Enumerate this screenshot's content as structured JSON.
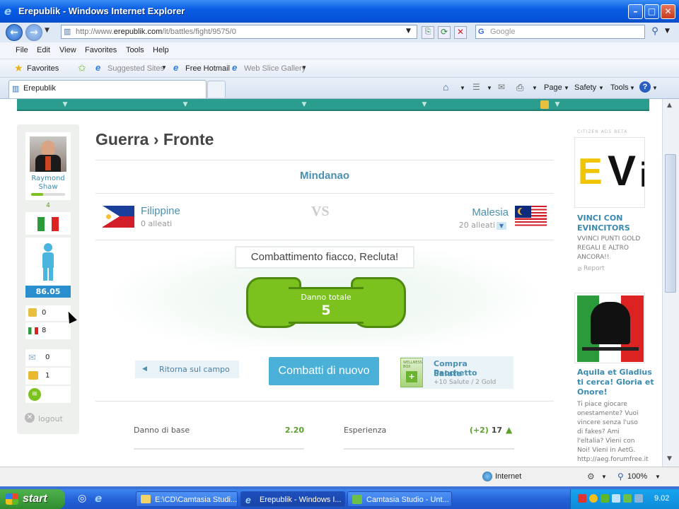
{
  "window": {
    "title": "Erepublik - Windows Internet Explorer"
  },
  "address": {
    "prefix": "http://www.",
    "domain": "erepublik.com",
    "suffix": "/it/battles/fight/9575/0"
  },
  "search": {
    "placeholder": "Google"
  },
  "menu": [
    "File",
    "Edit",
    "View",
    "Favorites",
    "Tools",
    "Help"
  ],
  "favorites": {
    "favorites_label": "Favorites",
    "suggested": "Suggested Sites",
    "hotmail": "Free Hotmail",
    "webslice": "Web Slice Gallery"
  },
  "tab": {
    "label": "Erepublik"
  },
  "commands": {
    "page": "Page",
    "safety": "Safety",
    "tools": "Tools"
  },
  "sidebar": {
    "user_name_1": "Raymond",
    "user_name_2": "Shaw",
    "level": "4",
    "wellness": "86.05",
    "gold": "0",
    "currency": "8",
    "messages": "0",
    "alerts": "1",
    "logout": "logout"
  },
  "main": {
    "title": "Guerra › Fronte",
    "region": "Mindanao",
    "left_country": "Filippine",
    "left_allies": "0 alleati",
    "vs": "VS",
    "right_country": "Malesia",
    "right_allies": "20 alleati",
    "message": "Combattimento fiacco, Recluta!",
    "damage_label": "Danno totale",
    "damage_value": "5",
    "return_label": "Ritorna sul campo",
    "fight_again": "Combatti di nuovo",
    "wellness_box_label": "WELLNESS BOX",
    "buy_pack_1": "Compra Pacchetto",
    "buy_pack_2": "Salute",
    "buy_pack_sub": "+10 Salute / 2 Gold",
    "base_damage_label": "Danno di base",
    "base_damage_value": "2.20",
    "experience_label": "Esperienza",
    "experience_delta": "(+2)",
    "experience_value": "17"
  },
  "ads": {
    "header": "CITIZEN ADS BETA",
    "ad1_title_1": "VINCI CON",
    "ad1_title_2": "EVINCITORS",
    "ad1_text_1": "VVINCI PUNTI GOLD",
    "ad1_text_2": "REGALI E ALTRO",
    "ad1_text_3": "ANCORA!!",
    "report": "Report",
    "ad2_title_1": "Aquila et Gladius",
    "ad2_title_2": "ti cerca! Gloria et",
    "ad2_title_3": "Onore!",
    "ad2_text": [
      "Ti piace giocare",
      "onestamente? Vuoi",
      "vincere senza l'uso",
      "di fakes? Ami",
      "l'eltalia? Vieni con",
      "Noi! Vieni in AetG.",
      "http://aeg.forumfree.it"
    ]
  },
  "status": {
    "zone": "Internet",
    "zoom": "100%"
  },
  "taskbar": {
    "start": "start",
    "tasks": [
      "E:\\CD\\Camtasia Studi...",
      "Erepublik - Windows I...",
      "Camtasia Studio - Unt..."
    ],
    "time": "9.02"
  },
  "colors": {
    "accent_teal": "#2a9d8f",
    "fist_green": "#7cc21e",
    "fight_button": "#4bb0d8"
  }
}
